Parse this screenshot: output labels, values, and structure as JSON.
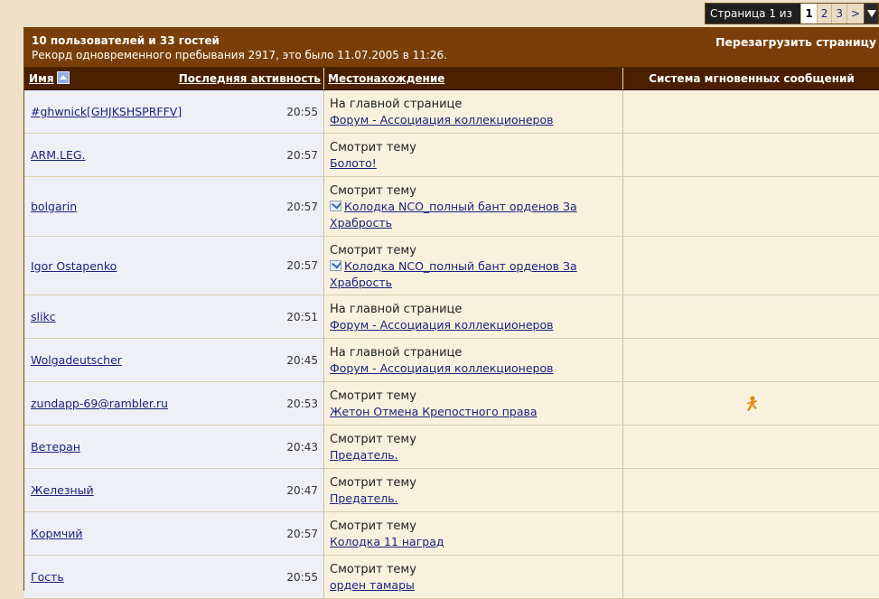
{
  "pager": {
    "label": "Страница 1 из 3",
    "pages": [
      "1",
      "2",
      "3",
      ">"
    ],
    "current": "1"
  },
  "header": {
    "count": "10 пользователей и 33 гостей",
    "record": "Рекорд одновременного пребывания 2917, это было 11.07.2005 в 11:26.",
    "reload": "Перезагрузить страницу"
  },
  "columns": {
    "name": "Имя",
    "last_activity": "Последняя активность",
    "location": "Местонахождение",
    "im": "Система мгновенных сообщений"
  },
  "colors": {
    "header_bg": "#7a3f08",
    "colhead_bg": "#4a2000",
    "link": "#1a237e",
    "page_bg": "#efe1c8"
  },
  "rows": [
    {
      "user": "#ghwnick[GHJKSHSPRFFV]",
      "time": "20:55",
      "action": "На главной странице",
      "place": "Форум - Ассоциация коллекционеров",
      "place_line2": "",
      "thread_icon": false,
      "im": false
    },
    {
      "user": "ARM.LEG.",
      "time": "20:57",
      "action": "Смотрит тему",
      "place": "Болото!",
      "place_line2": "",
      "thread_icon": false,
      "im": false
    },
    {
      "user": "bolgarin",
      "time": "20:57",
      "action": "Смотрит тему",
      "place": "Колодка NCO_полный бант орденов За",
      "place_line2": "Храбрость",
      "thread_icon": true,
      "im": false
    },
    {
      "user": "Igor Ostapenko",
      "time": "20:57",
      "action": "Смотрит тему",
      "place": "Колодка NCO_полный бант орденов За",
      "place_line2": "Храбрость",
      "thread_icon": true,
      "im": false
    },
    {
      "user": "slikc",
      "time": "20:51",
      "action": "На главной странице",
      "place": "Форум - Ассоциация коллекционеров",
      "place_line2": "",
      "thread_icon": false,
      "im": false
    },
    {
      "user": "Wolgadeutscher",
      "time": "20:45",
      "action": "На главной странице",
      "place": "Форум - Ассоциация коллекционеров",
      "place_line2": "",
      "thread_icon": false,
      "im": false
    },
    {
      "user": "zundapp-69@rambler.ru",
      "time": "20:53",
      "action": "Смотрит тему",
      "place": "Жетон Отмена Крепостного права",
      "place_line2": "",
      "thread_icon": false,
      "im": true,
      "im_icon": "icq-flower-icon"
    },
    {
      "user": "Ветеран",
      "time": "20:43",
      "action": "Смотрит тему",
      "place": "Предатель.",
      "place_line2": "",
      "thread_icon": false,
      "im": false
    },
    {
      "user": "Железный",
      "time": "20:47",
      "action": "Смотрит тему",
      "place": "Предатель.",
      "place_line2": "",
      "thread_icon": false,
      "im": false
    },
    {
      "user": "Кормчий",
      "time": "20:57",
      "action": "Смотрит тему",
      "place": "Колодка 11 наград",
      "place_line2": "",
      "thread_icon": false,
      "im": false
    },
    {
      "user": "Гость",
      "time": "20:55",
      "action": "Смотрит тему",
      "place": "орден тамары",
      "place_line2": "",
      "thread_icon": false,
      "im": false
    }
  ]
}
